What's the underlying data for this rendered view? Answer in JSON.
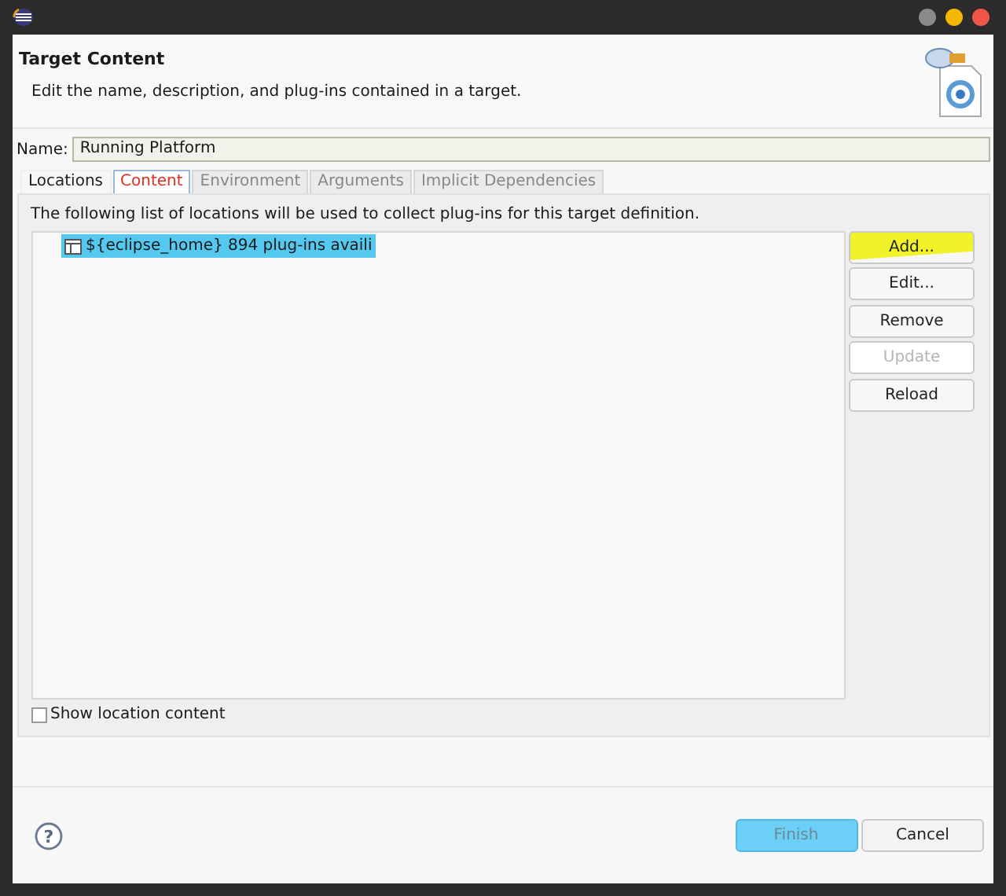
{
  "header": {
    "title": "Target Content",
    "description": "Edit the name, description, and plug-ins contained in a target."
  },
  "name_field": {
    "label": "Name:",
    "value": "Running Platform"
  },
  "tabs": [
    {
      "label": "Locations",
      "selected": true,
      "error": false
    },
    {
      "label": "Content",
      "selected": false,
      "error": true
    },
    {
      "label": "Environment",
      "selected": false,
      "error": false
    },
    {
      "label": "Arguments",
      "selected": false,
      "error": false
    },
    {
      "label": "Implicit Dependencies",
      "selected": false,
      "error": false
    }
  ],
  "intro": "The following list of locations will be used to collect plug-ins for this target definition.",
  "locations": [
    {
      "label": "${eclipse_home} 894 plug-ins availi",
      "selected": true
    }
  ],
  "side_buttons": [
    {
      "label": "Add...",
      "disabled": false,
      "highlighted": true
    },
    {
      "label": "Edit...",
      "disabled": false,
      "highlighted": false
    },
    {
      "label": "Remove",
      "disabled": false,
      "highlighted": false
    },
    {
      "label": "Update",
      "disabled": true,
      "highlighted": false
    },
    {
      "label": "Reload",
      "disabled": false,
      "highlighted": false
    }
  ],
  "show_content": {
    "label": "Show location content",
    "checked": false
  },
  "footer": {
    "help": "?",
    "buttons": [
      {
        "label": "Finish",
        "kind": "default"
      },
      {
        "label": "Cancel",
        "kind": "normal"
      }
    ]
  }
}
